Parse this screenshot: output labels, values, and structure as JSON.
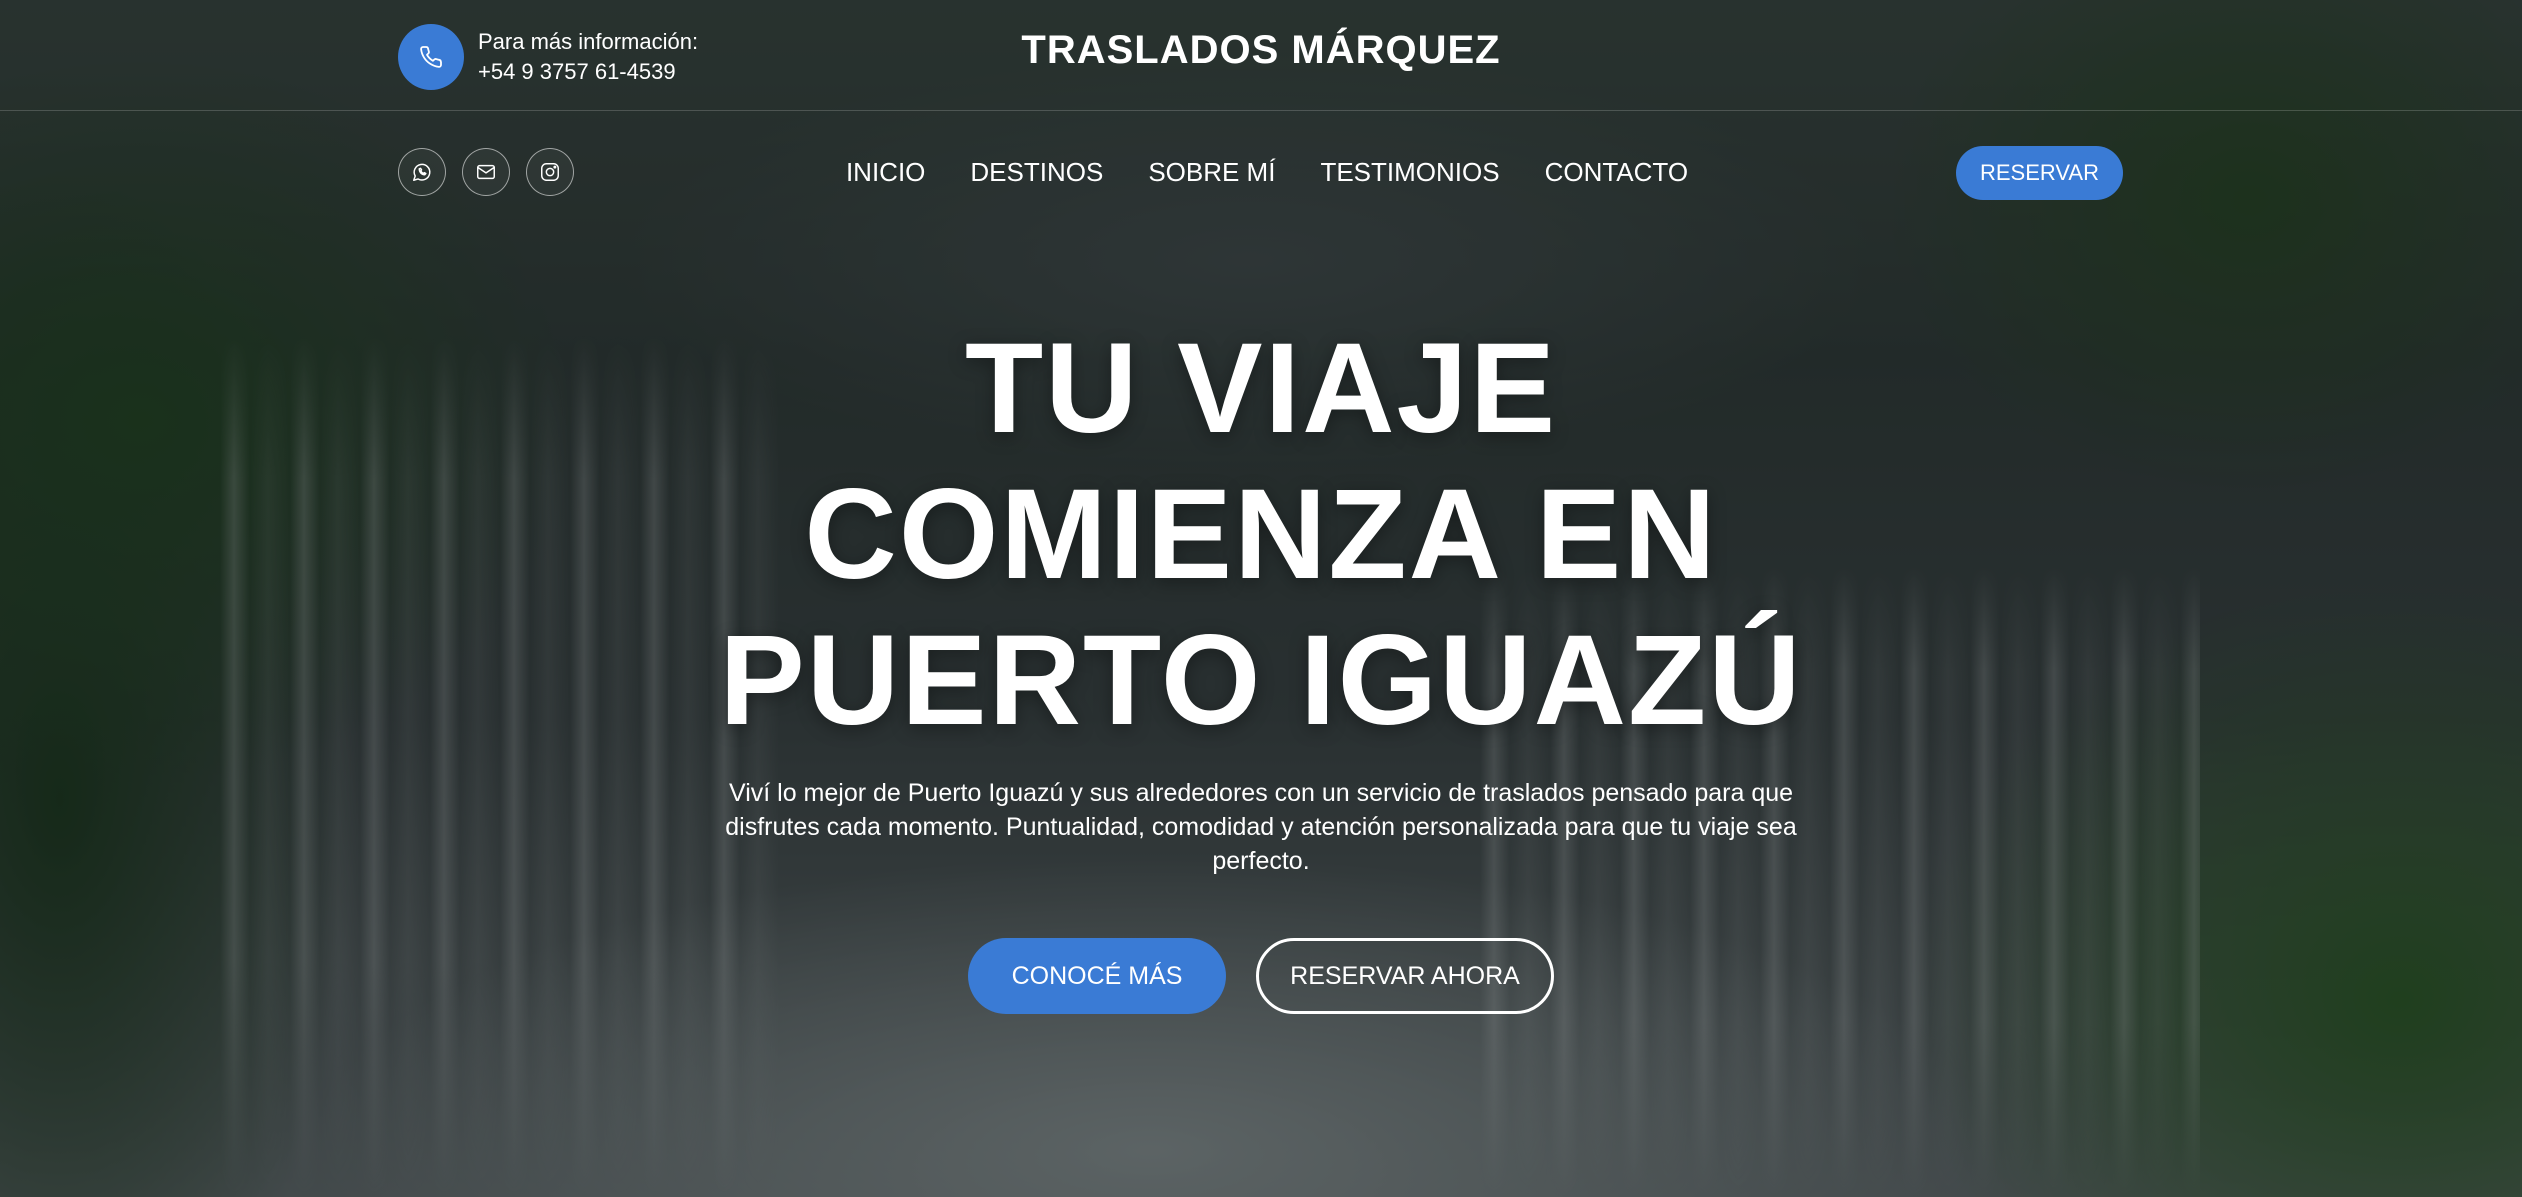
{
  "header": {
    "contact_label": "Para más información:",
    "contact_phone": "+54 9 3757 61-4539",
    "brand": "TRASLADOS MÁRQUEZ",
    "icons": {
      "phone": "phone-icon",
      "whatsapp": "whatsapp-icon",
      "email": "mail-icon",
      "instagram": "instagram-icon"
    }
  },
  "nav": {
    "items": [
      {
        "label": "INICIO"
      },
      {
        "label": "DESTINOS"
      },
      {
        "label": "SOBRE MÍ"
      },
      {
        "label": "TESTIMONIOS"
      },
      {
        "label": "CONTACTO"
      }
    ],
    "reserve_label": "RESERVAR"
  },
  "hero": {
    "headline_lines": [
      "TU VIAJE",
      "COMIENZA EN",
      "PUERTO IGUAZÚ"
    ],
    "subtitle": "Viví lo mejor de Puerto Iguazú y sus alrededores con un servicio de traslados pensado para que disfrutes cada momento. Puntualidad, comodidad y atención personalizada para que tu viaje sea perfecto.",
    "primary_cta": "CONOCÉ MÁS",
    "secondary_cta": "RESERVAR AHORA"
  },
  "colors": {
    "accent": "#3a7bd5",
    "text": "#ffffff"
  }
}
